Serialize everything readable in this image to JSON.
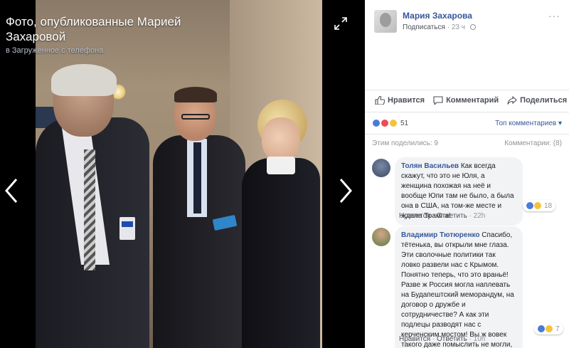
{
  "viewer": {
    "title": "Фото, опубликованные Марией Захаровой",
    "subtitle": "в Загруженное с телефона"
  },
  "post": {
    "author": "Мария Захарова",
    "subscribe": "Подписаться",
    "time": "23 ч",
    "more": "···"
  },
  "actions": {
    "like": "Нравится",
    "comment": "Комментарий",
    "share": "Поделиться"
  },
  "reactions": {
    "count": "51",
    "top_comments": "Топ комментариев ▾",
    "shares": "Этим поделились: 9",
    "comments": "Комментарии: (8)"
  },
  "comments": [
    {
      "author": "Толян Васильев",
      "text": "Как всегда скажут, что это не Юля, а женщина похожая на неё и вообще Юпи там не было, а была она в США, на том-же месте и ждала Трампа!",
      "like": "Нравится",
      "reply": "Ответить",
      "time": "22h",
      "reactions": "18"
    },
    {
      "author": "Владимир Тютюренко",
      "text": "Спасибо, тётенька, вы открыли мне глаза. Эти сволочные политики так ловко развели нас с Крымом. Понятно теперь, что это враньё! Разве ж Россия могла наплевать на Будапештский меморандум, на договор о дружбе и сотрудничестве? А как эти подлецы разводят нас с керченским мостом! Вы ж вовек такого даже помыслить не могли, папочки наши святые.",
      "like": "Нравится",
      "reply": "Ответить",
      "time": "10h",
      "reactions": "7"
    }
  ],
  "colors": {
    "link": "#365899",
    "muted": "#90949c",
    "bubble": "#f2f3f5"
  }
}
